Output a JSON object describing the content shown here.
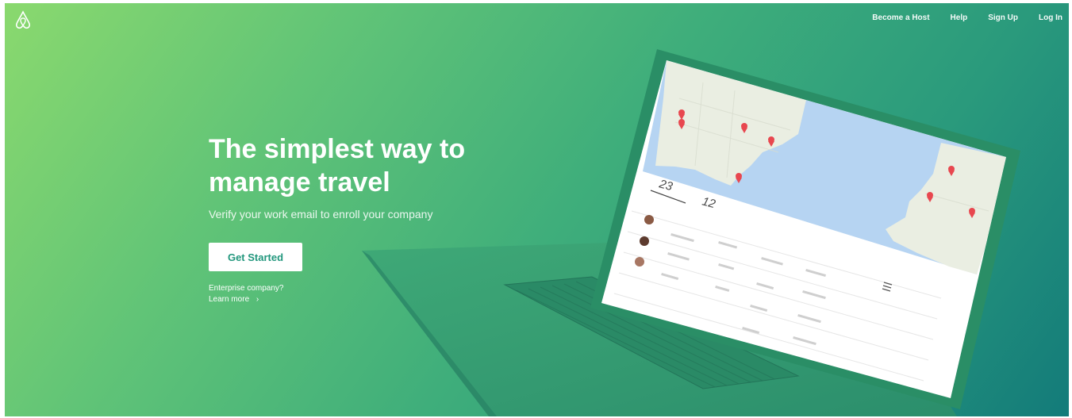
{
  "brand": {
    "logo_icon": "airbnb-belo-icon"
  },
  "nav": {
    "items": [
      "Become a Host",
      "Help",
      "Sign Up",
      "Log In"
    ]
  },
  "hero": {
    "headline_line1": "The simplest way to",
    "headline_line2": "manage travel",
    "subtitle": "Verify your work email to enroll your company",
    "cta_label": "Get Started",
    "enterprise_question": "Enterprise company?",
    "learn_more": "Learn more",
    "learn_more_chevron": "›"
  },
  "laptop_screen": {
    "stat1": {
      "number": "23"
    },
    "stat2": {
      "number": "12"
    }
  },
  "colors": {
    "gradient_start": "#8ad96e",
    "gradient_end": "#137b7a",
    "cta_text": "#22977d",
    "map_pin": "#e8474f",
    "laptop_body": "#2e9a6f"
  }
}
